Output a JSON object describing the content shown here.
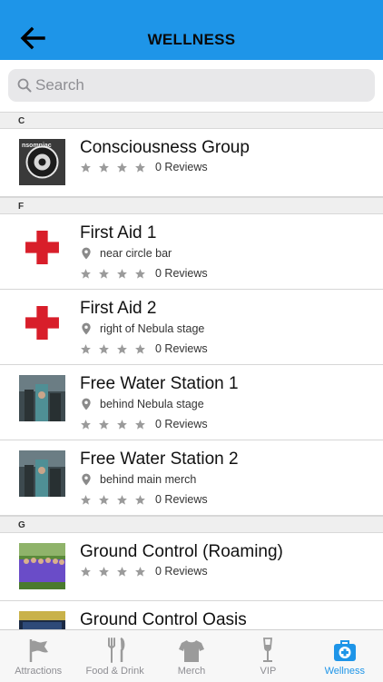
{
  "header": {
    "title": "WELLNESS"
  },
  "search": {
    "placeholder": "Search"
  },
  "sections": [
    {
      "letter": "C"
    },
    {
      "letter": "F"
    },
    {
      "letter": "G"
    }
  ],
  "items": [
    {
      "title": "Consciousness Group",
      "location": "",
      "reviews": "0 Reviews",
      "thumb": "insomniac-logo"
    },
    {
      "title": "First Aid 1",
      "location": "near circle bar",
      "reviews": "0 Reviews",
      "thumb": "red-cross"
    },
    {
      "title": "First Aid 2",
      "location": "right of Nebula stage",
      "reviews": "0 Reviews",
      "thumb": "red-cross"
    },
    {
      "title": "Free Water Station 1",
      "location": "behind Nebula stage",
      "reviews": "0 Reviews",
      "thumb": "water-station-photo"
    },
    {
      "title": "Free Water Station 2",
      "location": "behind main merch",
      "reviews": "0 Reviews",
      "thumb": "water-station-photo"
    },
    {
      "title": "Ground Control (Roaming)",
      "location": "",
      "reviews": "0 Reviews",
      "thumb": "group-photo"
    },
    {
      "title": "Ground Control Oasis",
      "location": "",
      "reviews": "",
      "thumb": "oasis-photo"
    }
  ],
  "tabs": [
    {
      "label": "Attractions",
      "icon": "flag-icon",
      "active": false
    },
    {
      "label": "Food & Drink",
      "icon": "fork-knife-icon",
      "active": false
    },
    {
      "label": "Merch",
      "icon": "shirt-icon",
      "active": false
    },
    {
      "label": "VIP",
      "icon": "champagne-icon",
      "active": false
    },
    {
      "label": "Wellness",
      "icon": "first-aid-kit-icon",
      "active": true
    }
  ],
  "colors": {
    "accent": "#1e95e8",
    "star": "#9b9b9b",
    "cross": "#d81e2a"
  }
}
